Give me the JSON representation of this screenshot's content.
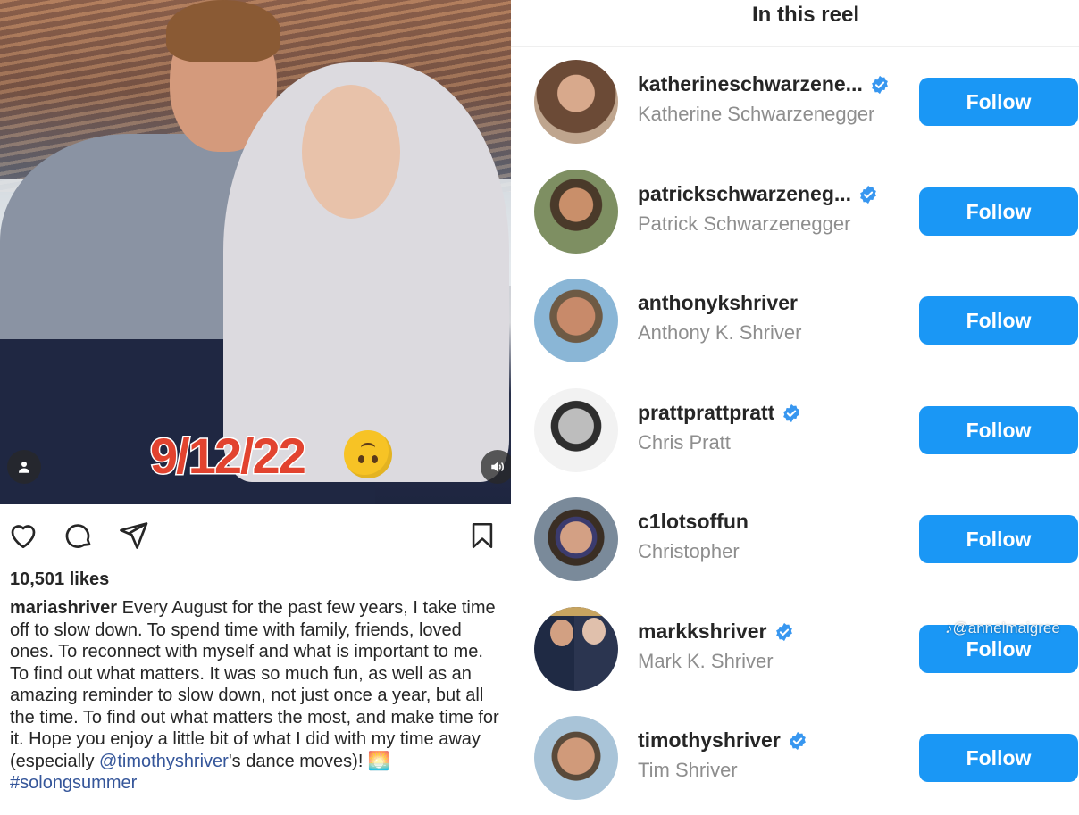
{
  "post": {
    "date_sticker": "9/12/22",
    "likes": "10,501 likes",
    "caption_user": "mariashriver",
    "caption_text_1": " Every August for the past few years, I take time off to slow down. To spend time with family, friends, loved ones. To reconnect with myself and what is important to me. To find out what matters. It was so much fun, as well as an amazing reminder to slow down, not just once a year, but all the time. To find out what matters the most, and make time for it. Hope you enjoy a little bit of what I did with my time away (especially ",
    "caption_mention": "@timothyshriver",
    "caption_text_2": "'s dance moves)! 🌅",
    "caption_hashtag": "#solongsummer",
    "icons": [
      "tag-people-icon",
      "volume-icon",
      "heart-icon",
      "comment-icon",
      "share-icon",
      "bookmark-icon"
    ]
  },
  "panel": {
    "title": "In this reel",
    "watermark": "♪@annelmaigree",
    "rows": [
      {
        "handle": "katherineschwarzene...",
        "name": "Katherine Schwarzenegger",
        "verified": true,
        "button": "Follow"
      },
      {
        "handle": "patrickschwarzeneg...",
        "name": "Patrick Schwarzenegger",
        "verified": true,
        "button": "Follow"
      },
      {
        "handle": "anthonykshriver",
        "name": "Anthony K. Shriver",
        "verified": false,
        "button": "Follow"
      },
      {
        "handle": "prattprattpratt",
        "name": "Chris Pratt",
        "verified": true,
        "button": "Follow"
      },
      {
        "handle": "c1lotsoffun",
        "name": "Christopher",
        "verified": false,
        "button": "Follow"
      },
      {
        "handle": "markkshriver",
        "name": "Mark K. Shriver",
        "verified": true,
        "button": "Follow"
      },
      {
        "handle": "timothyshriver",
        "name": "Tim Shriver",
        "verified": true,
        "button": "Follow"
      }
    ]
  },
  "colors": {
    "follow": "#1a97f5",
    "verified": "#3897f0",
    "link": "#35569a",
    "secondary_text": "#8e8e8e"
  }
}
